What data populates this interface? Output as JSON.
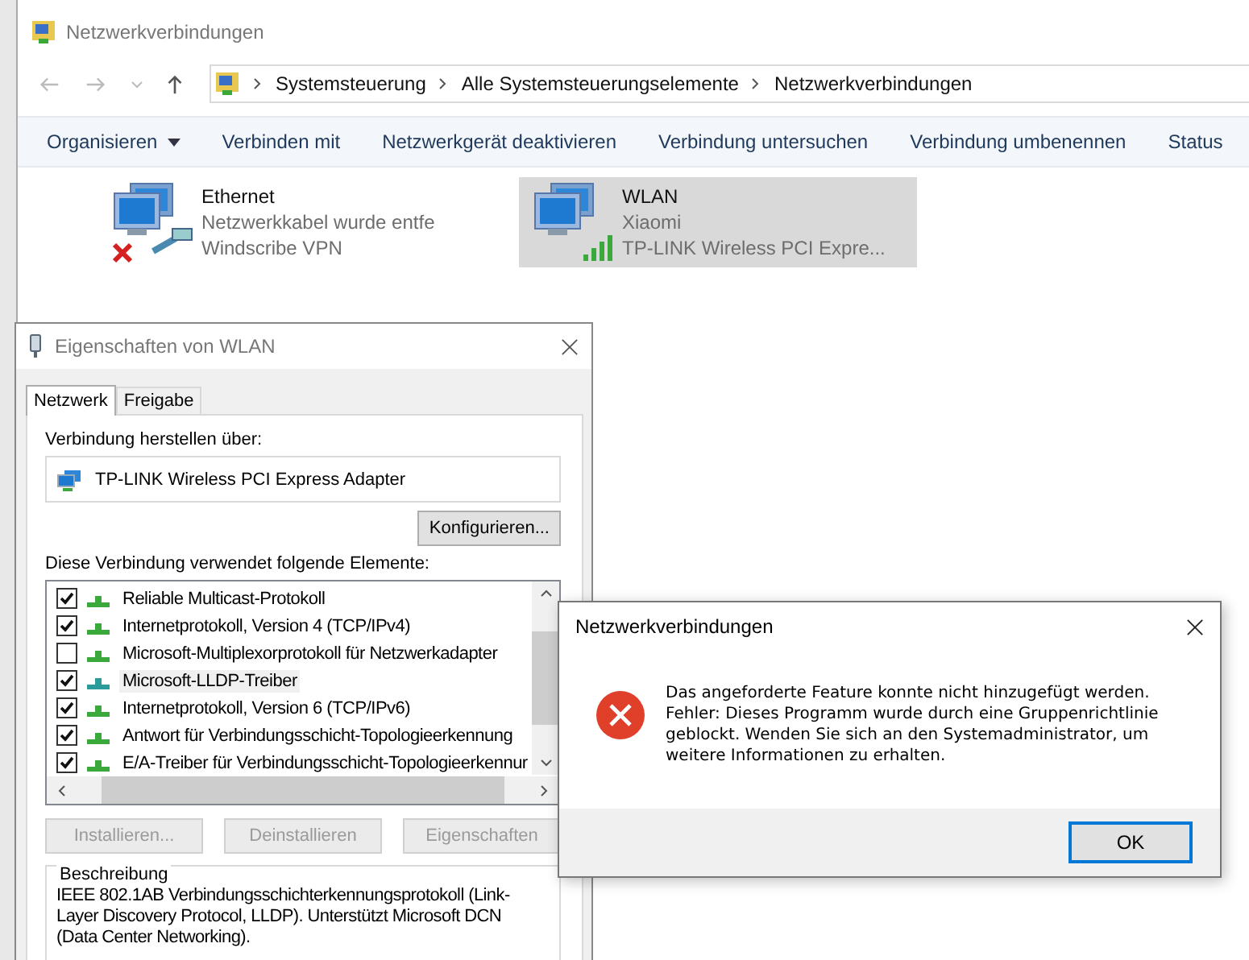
{
  "explorer": {
    "title": "Netzwerkverbindungen",
    "breadcrumb": [
      "Systemsteuerung",
      "Alle Systemsteuerungselemente",
      "Netzwerkverbindungen"
    ],
    "commands": [
      {
        "label": "Organisieren",
        "dropdown": true
      },
      {
        "label": "Verbinden mit",
        "dropdown": false
      },
      {
        "label": "Netzwerkgerät deaktivieren",
        "dropdown": false
      },
      {
        "label": "Verbindung untersuchen",
        "dropdown": false
      },
      {
        "label": "Verbindung umbenennen",
        "dropdown": false
      },
      {
        "label": "Status",
        "dropdown": false
      }
    ],
    "connections": [
      {
        "kind": "ethernet",
        "name": "Ethernet",
        "lines": [
          "Netzwerkkabel wurde entfe",
          "Windscribe VPN"
        ],
        "disconnected": true,
        "selected": false
      },
      {
        "kind": "wifi",
        "name": "WLAN",
        "lines": [
          "Xiaomi",
          "TP-LINK Wireless PCI Expre..."
        ],
        "disconnected": false,
        "selected": true
      }
    ]
  },
  "properties": {
    "title": "Eigenschaften von WLAN",
    "tabs": [
      {
        "label": "Netzwerk",
        "selected": true
      },
      {
        "label": "Freigabe",
        "selected": false
      }
    ],
    "connect_label": "Verbindung herstellen über:",
    "adapter": "TP-LINK Wireless PCI Express Adapter",
    "configure_button": "Konfigurieren...",
    "items_label": "Diese Verbindung verwendet folgende Elemente:",
    "items": [
      {
        "label": "Reliable Multicast-Protokoll",
        "checked": true,
        "selected": false,
        "color": "#3aa83a"
      },
      {
        "label": "Internetprotokoll, Version 4 (TCP/IPv4)",
        "checked": true,
        "selected": false,
        "color": "#3aa83a"
      },
      {
        "label": "Microsoft-Multiplexorprotokoll für Netzwerkadapter",
        "checked": false,
        "selected": false,
        "color": "#3aa83a"
      },
      {
        "label": "Microsoft-LLDP-Treiber",
        "checked": true,
        "selected": true,
        "color": "#2a9a9a"
      },
      {
        "label": "Internetprotokoll, Version 6 (TCP/IPv6)",
        "checked": true,
        "selected": false,
        "color": "#3aa83a"
      },
      {
        "label": "Antwort für Verbindungsschicht-Topologieerkennung",
        "checked": true,
        "selected": false,
        "color": "#3aa83a"
      },
      {
        "label": "E/A-Treiber für Verbindungsschicht-Topologieerkennur",
        "checked": true,
        "selected": false,
        "color": "#3aa83a"
      }
    ],
    "buttons": [
      {
        "label": "Installieren...",
        "disabled": true
      },
      {
        "label": "Deinstallieren",
        "disabled": true
      },
      {
        "label": "Eigenschaften",
        "disabled": true
      }
    ],
    "description": {
      "legend": "Beschreibung",
      "text": "IEEE 802.1AB Verbindungsschichterkennungsprotokoll (Link-Layer Discovery Protocol, LLDP). Unterstützt Microsoft DCN (Data Center Networking)."
    }
  },
  "error": {
    "title": "Netzwerkverbindungen",
    "message": "Das angeforderte Feature konnte nicht hinzugefügt werden. Fehler: Dieses Programm wurde durch eine Gruppenrichtlinie geblockt. Wenden Sie sich an den Systemadministrator, um weitere Informationen zu erhalten.",
    "button": "OK"
  }
}
